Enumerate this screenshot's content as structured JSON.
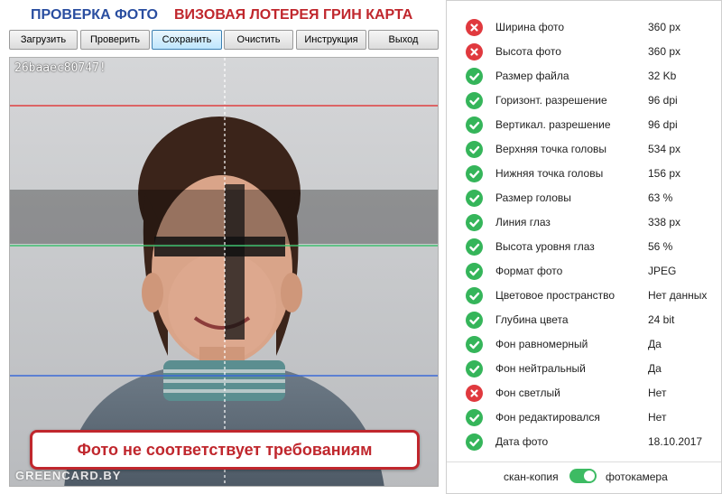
{
  "header": {
    "title_check": "ПРОВЕРКА ФОТО",
    "title_lottery": "ВИЗОВАЯ ЛОТЕРЕЯ ГРИН КАРТА"
  },
  "toolbar": {
    "load": "Загрузить",
    "check": "Проверить",
    "save": "Сохранить",
    "clear": "Очистить",
    "instructions": "Инструкция",
    "exit": "Выход"
  },
  "photo": {
    "id_text": "26baaec80747!",
    "watermark": "GREENCARD.BY",
    "warning": "Фото не соответствует требованиям"
  },
  "checks": [
    {
      "label": "Ширина фото",
      "value": "360 px",
      "status": "fail"
    },
    {
      "label": "Высота фото",
      "value": "360 px",
      "status": "fail"
    },
    {
      "label": "Размер файла",
      "value": "32 Kb",
      "status": "ok"
    },
    {
      "label": "Горизонт. разрешение",
      "value": "96 dpi",
      "status": "ok"
    },
    {
      "label": "Вертикал. разрешение",
      "value": "96 dpi",
      "status": "ok"
    },
    {
      "label": "Верхняя точка головы",
      "value": "534 px",
      "status": "ok"
    },
    {
      "label": "Нижняя точка головы",
      "value": "156 px",
      "status": "ok"
    },
    {
      "label": "Размер головы",
      "value": "63 %",
      "status": "ok"
    },
    {
      "label": "Линия глаз",
      "value": "338 px",
      "status": "ok"
    },
    {
      "label": "Высота уровня глаз",
      "value": "56 %",
      "status": "ok"
    },
    {
      "label": "Формат фото",
      "value": "JPEG",
      "status": "ok"
    },
    {
      "label": "Цветовое пространство",
      "value": "Нет данных",
      "status": "ok"
    },
    {
      "label": "Глубина цвета",
      "value": "24 bit",
      "status": "ok"
    },
    {
      "label": "Фон равномерный",
      "value": "Да",
      "status": "ok"
    },
    {
      "label": "Фон нейтральный",
      "value": "Да",
      "status": "ok"
    },
    {
      "label": "Фон светлый",
      "value": "Нет",
      "status": "fail"
    },
    {
      "label": "Фон редактировался",
      "value": "Нет",
      "status": "ok"
    },
    {
      "label": "Дата фото",
      "value": "18.10.2017",
      "status": "ok"
    }
  ],
  "source_switch": {
    "left_label": "скан-копия",
    "right_label": "фотокамера",
    "selected": "фотокамера"
  },
  "colors": {
    "ok": "#35b55a",
    "fail": "#e0393e",
    "title_blue": "#2a4ea0",
    "title_red": "#c0272d"
  }
}
